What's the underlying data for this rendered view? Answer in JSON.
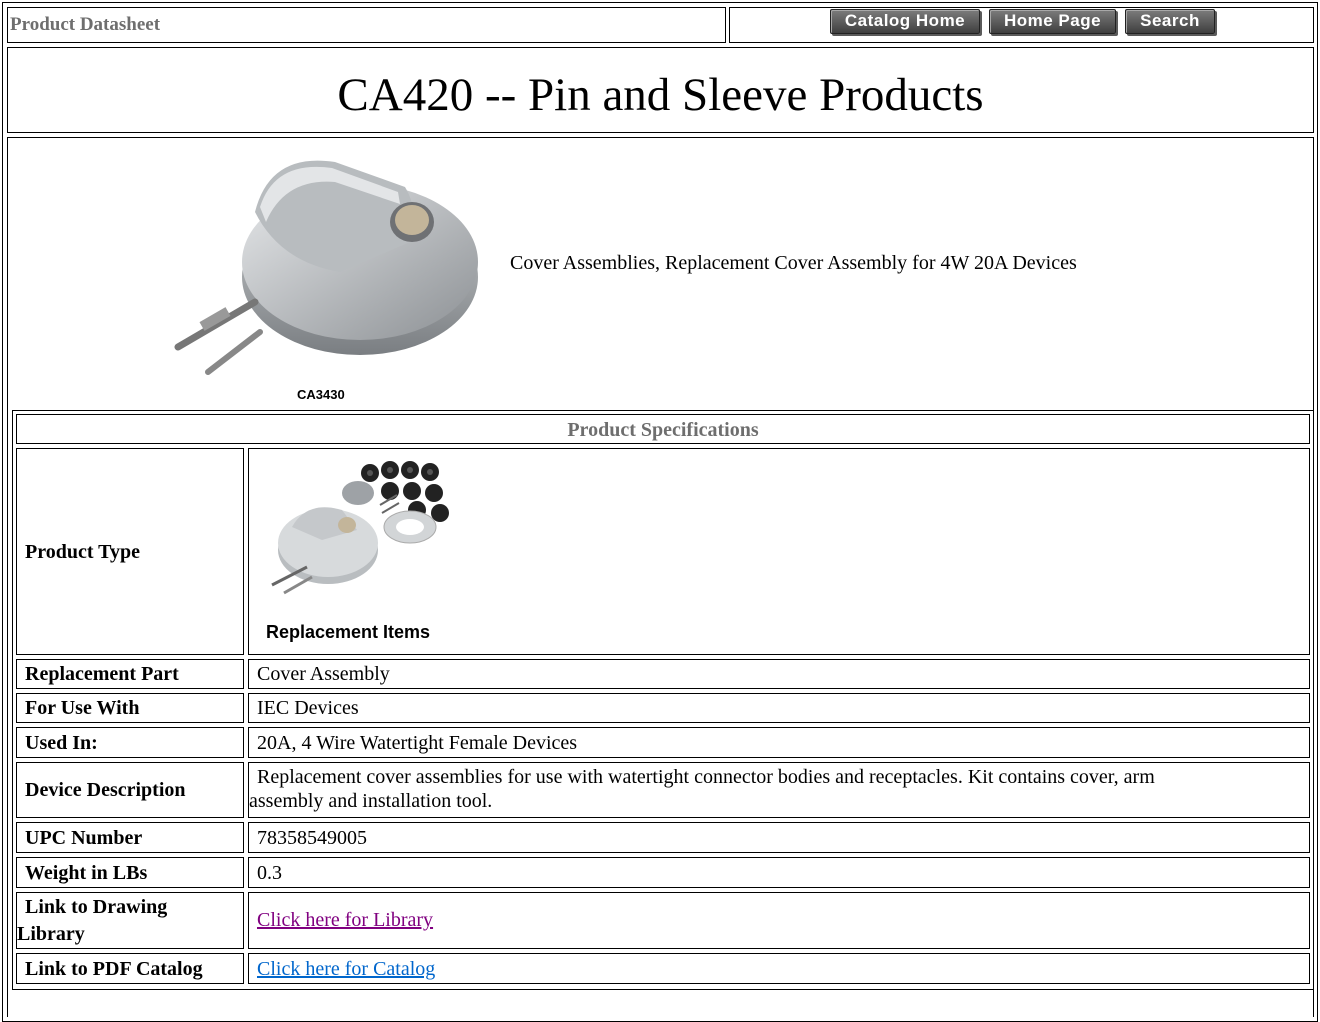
{
  "header": {
    "label": "Product Datasheet",
    "buttons": {
      "catalog_home": "Catalog Home",
      "home_page": "Home Page",
      "search": "Search"
    }
  },
  "title": "CA420 -- Pin and Sleeve Products",
  "product": {
    "image_caption": "CA3430",
    "description": "Cover Assemblies, Replacement Cover Assembly for 4W 20A Devices"
  },
  "specs": {
    "heading": "Product Specifications",
    "product_type": {
      "label": "Product Type",
      "image_caption": "Replacement Items"
    },
    "rows": [
      {
        "label": "Replacement Part",
        "value": "Cover Assembly"
      },
      {
        "label": "For Use With",
        "value": "IEC Devices"
      },
      {
        "label": "Used In:",
        "value": "20A, 4 Wire Watertight Female Devices"
      },
      {
        "label": "Device Description",
        "value_line1": "Replacement cover assemblies for use with watertight connector bodies and receptacles. Kit contains cover, arm",
        "value_line2": "assembly and installation tool."
      },
      {
        "label": "UPC Number",
        "value": "78358549005"
      },
      {
        "label": "Weight in LBs",
        "value": "0.3"
      },
      {
        "label_line1": "Link to Drawing",
        "label_line2": "Library",
        "value": "Click here for Library"
      },
      {
        "label": "Link to PDF Catalog",
        "value": "Click here for Catalog"
      }
    ]
  },
  "colors": {
    "visited_link": "#800080",
    "link": "#0066cc",
    "muted_header_text": "#6e6e6e"
  }
}
